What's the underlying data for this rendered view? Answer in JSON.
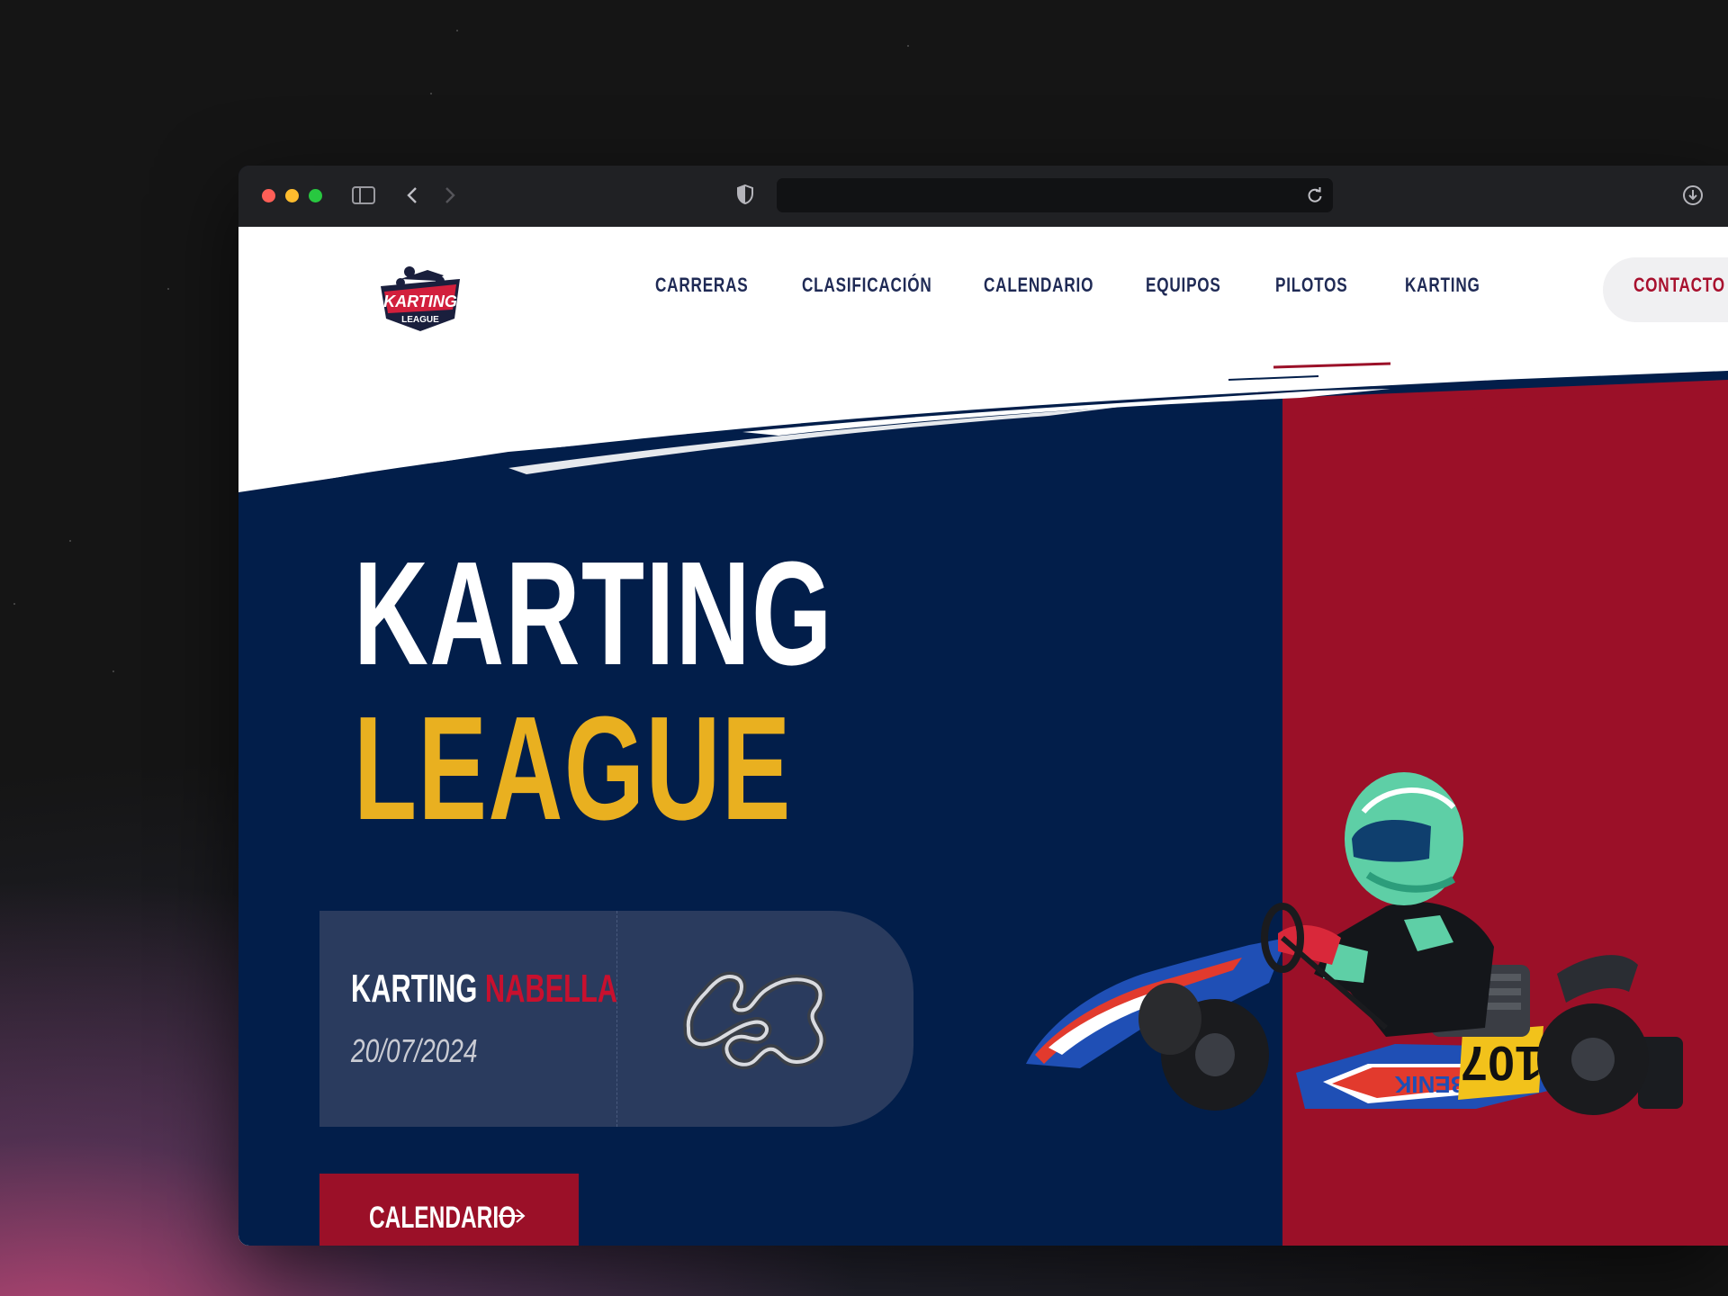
{
  "browser": {
    "url": "",
    "colors": {
      "close": "#ff5f57",
      "minimize": "#febc2e",
      "zoom": "#28c840"
    }
  },
  "nav": {
    "logo_alt": "Karting League",
    "logo_text_top": "KARTING",
    "logo_text_bottom": "LEAGUE",
    "items": [
      {
        "label": "CARRERAS"
      },
      {
        "label": "CLASIFICACIÓN"
      },
      {
        "label": "CALENDARIO"
      },
      {
        "label": "EQUIPOS"
      },
      {
        "label": "PILOTOS"
      },
      {
        "label": "KARTING"
      }
    ],
    "contact_label": "CONTACTO"
  },
  "hero": {
    "title_line1": "KARTING",
    "title_line2": "LEAGUE",
    "colors": {
      "navy": "#021e4a",
      "crimson": "#9b1028",
      "gold": "#e9b020"
    }
  },
  "next_race": {
    "name_part1": "KARTING",
    "name_part2": "NABELLA",
    "date": "20/07/2024",
    "track_icon": "track-layout-icon"
  },
  "cta": {
    "label": "CALENDARIO",
    "icon": "arrow-right-icon"
  },
  "kart": {
    "number": "107",
    "brand": "BENIK"
  }
}
